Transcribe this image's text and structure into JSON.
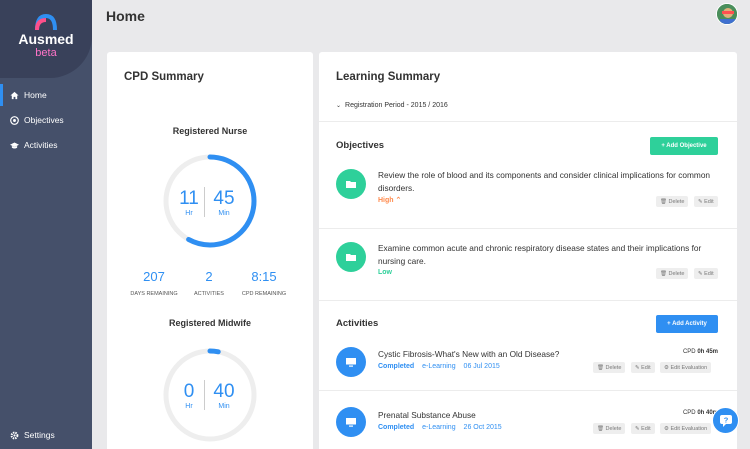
{
  "app": {
    "name": "Ausmed",
    "badge": "beta"
  },
  "sidebar": {
    "items": [
      {
        "label": "Home",
        "icon": "home-icon"
      },
      {
        "label": "Objectives",
        "icon": "target-icon"
      },
      {
        "label": "Activities",
        "icon": "graduation-cap-icon"
      }
    ],
    "settings_label": "Settings"
  },
  "header": {
    "title": "Home"
  },
  "cpd": {
    "title": "CPD Summary",
    "nurse": {
      "label": "Registered Nurse",
      "hours": "11",
      "hours_unit": "Hr",
      "minutes": "45",
      "minutes_unit": "Min",
      "progress": 0.58,
      "stats": [
        {
          "value": "207",
          "label": "DAYS REMAINING"
        },
        {
          "value": "2",
          "label": "ACTIVITIES"
        },
        {
          "value": "8:15",
          "label": "CPD REMAINING"
        }
      ]
    },
    "midwife": {
      "label": "Registered Midwife",
      "hours": "0",
      "hours_unit": "Hr",
      "minutes": "40",
      "minutes_unit": "Min",
      "progress": 0.03
    }
  },
  "learning": {
    "title": "Learning Summary",
    "period": "Registration Period - 2015 / 2016",
    "objectives": {
      "title": "Objectives",
      "add_label": "+ Add Objective",
      "items": [
        {
          "text": "Review the role of blood and its components and consider clinical implications for common disorders.",
          "priority": "High",
          "priority_color": "#ff8a4c"
        },
        {
          "text": "Examine common acute and chronic respiratory disease states and their implications for nursing care.",
          "priority": "Low",
          "priority_color": "#2ed09a"
        }
      ],
      "delete_label": "Delete",
      "edit_label": "Edit"
    },
    "activities": {
      "title": "Activities",
      "add_label": "+ Add Activity",
      "items": [
        {
          "title": "Cystic Fibrosis-What's New with an Old Disease?",
          "status": "Completed",
          "type": "e-Learning",
          "date": "06 Jul 2015",
          "cpd_label": "CPD",
          "cpd_time": "0h 45m"
        },
        {
          "title": "Prenatal Substance Abuse",
          "status": "Completed",
          "type": "e-Learning",
          "date": "26 Oct 2015",
          "cpd_label": "CPD",
          "cpd_time": "0h 40m"
        }
      ],
      "delete_label": "Delete",
      "edit_label": "Edit",
      "evaluation_label": "Edit Evaluation"
    }
  },
  "colors": {
    "accent": "#2f8ff2",
    "green": "#2ed09a",
    "sidebar": "#45506a"
  }
}
